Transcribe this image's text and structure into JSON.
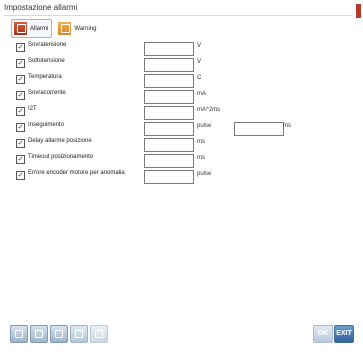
{
  "window": {
    "title": "Impostazione allarmi"
  },
  "tabs": [
    {
      "label": "Allarmi",
      "icon": "alarm-tab-icon"
    },
    {
      "label": "Warning",
      "icon": "warning-tab-icon"
    }
  ],
  "alarms": [
    {
      "label": "Sovratensione",
      "checked": true,
      "value": "",
      "unit": "V"
    },
    {
      "label": "Sottotensione",
      "checked": true,
      "value": "",
      "unit": "V"
    },
    {
      "label": "Temperatura",
      "checked": true,
      "value": "",
      "unit": "C"
    },
    {
      "label": "Sovracorrente",
      "checked": true,
      "value": "",
      "unit": "mA"
    },
    {
      "label": "I2T",
      "checked": true,
      "value": "",
      "unit": "mA^2ms"
    },
    {
      "label": "Inseguimento",
      "checked": true,
      "value": "",
      "unit": "pulse",
      "value2": "",
      "unit2": "ms"
    },
    {
      "label": "Delay allarme posizione",
      "checked": true,
      "value": "",
      "unit": "ms"
    },
    {
      "label": "Timeout posizionamento",
      "checked": true,
      "value": "",
      "unit": "ms"
    },
    {
      "label": "Errore encoder motore per anomalia",
      "checked": true,
      "value": "",
      "unit": "pulse"
    }
  ],
  "bottom": {
    "ok_label": "OK",
    "exit_label": "EXIT"
  },
  "colors": {
    "accent": "#b8382a",
    "exit": "#2e5f95"
  }
}
